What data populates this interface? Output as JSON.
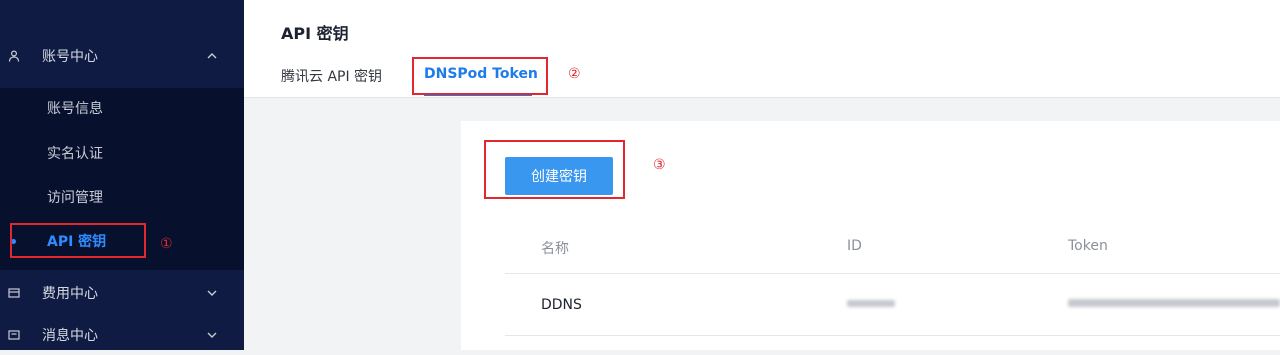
{
  "sidebar": {
    "groups": [
      {
        "label": "账号中心",
        "icon": "user-icon",
        "expanded": true
      },
      {
        "label": "费用中心",
        "icon": "wallet-icon",
        "expanded": false
      },
      {
        "label": "消息中心",
        "icon": "message-icon",
        "expanded": false
      }
    ],
    "sub_items": [
      {
        "label": "账号信息"
      },
      {
        "label": "实名认证"
      },
      {
        "label": "访问管理"
      },
      {
        "label": "API 密钥",
        "active": true
      }
    ]
  },
  "header": {
    "title": "API 密钥",
    "tabs": [
      {
        "label": "腾讯云 API 密钥"
      },
      {
        "label": "DNSPod Token",
        "active": true
      }
    ]
  },
  "annotations": {
    "one": "①",
    "two": "②",
    "three": "③"
  },
  "main": {
    "create_button": "创建密钥",
    "table": {
      "columns": [
        "名称",
        "ID",
        "Token"
      ],
      "rows": [
        {
          "name": "DDNS",
          "id": "(blurred)",
          "token": "(blurred)"
        }
      ]
    }
  },
  "colors": {
    "sidebar_bg": "#0f1b42",
    "submenu_bg": "#07112d",
    "accent": "#1e7bea",
    "button": "#3a97ef",
    "annotation_red": "#e0282e"
  }
}
